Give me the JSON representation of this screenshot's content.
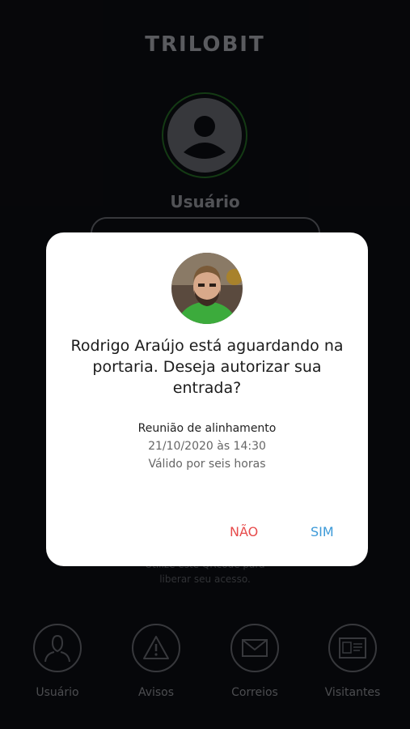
{
  "app": {
    "logo": "TRILOBIT",
    "user_label": "Usuário",
    "qr_hint_line1": "Utilize este QRcode para",
    "qr_hint_line2": "liberar seu acesso."
  },
  "nav": {
    "items": [
      {
        "label": "Usuário",
        "icon": "user-icon"
      },
      {
        "label": "Avisos",
        "icon": "warning-icon"
      },
      {
        "label": "Correios",
        "icon": "mail-icon"
      },
      {
        "label": "Visitantes",
        "icon": "id-card-icon"
      }
    ]
  },
  "dialog": {
    "message": "Rodrigo Araújo está aguardando na portaria. Deseja autorizar sua entrada?",
    "meeting_title": "Reunião de alinhamento",
    "meeting_datetime": "21/10/2020 às 14:30",
    "validity": "Válido por seis horas",
    "no_label": "NÃO",
    "yes_label": "SIM"
  },
  "colors": {
    "background": "#0a0b10",
    "accent_green": "#1f5a1f",
    "no_button": "#e74c4c",
    "yes_button": "#3d9ad8"
  }
}
